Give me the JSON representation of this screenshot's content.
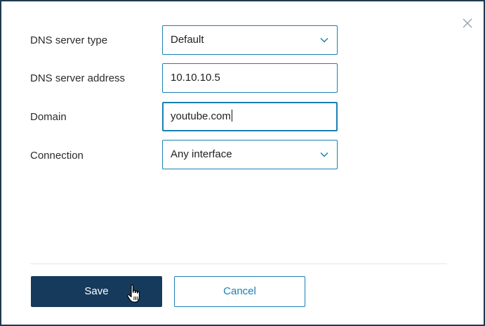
{
  "form": {
    "dns_server_type": {
      "label": "DNS server type",
      "value": "Default"
    },
    "dns_server_address": {
      "label": "DNS server address",
      "value": "10.10.10.5"
    },
    "domain": {
      "label": "Domain",
      "value": "youtube.com"
    },
    "connection": {
      "label": "Connection",
      "value": "Any interface"
    }
  },
  "actions": {
    "save_label": "Save",
    "cancel_label": "Cancel"
  },
  "icons": {
    "close": "close-icon",
    "dropdown": "chevron-down-icon",
    "cursor": "hand-pointer-icon"
  },
  "colors": {
    "accent": "#1a7fb3",
    "primary_button": "#163a5c",
    "border": "#1f3a52"
  }
}
